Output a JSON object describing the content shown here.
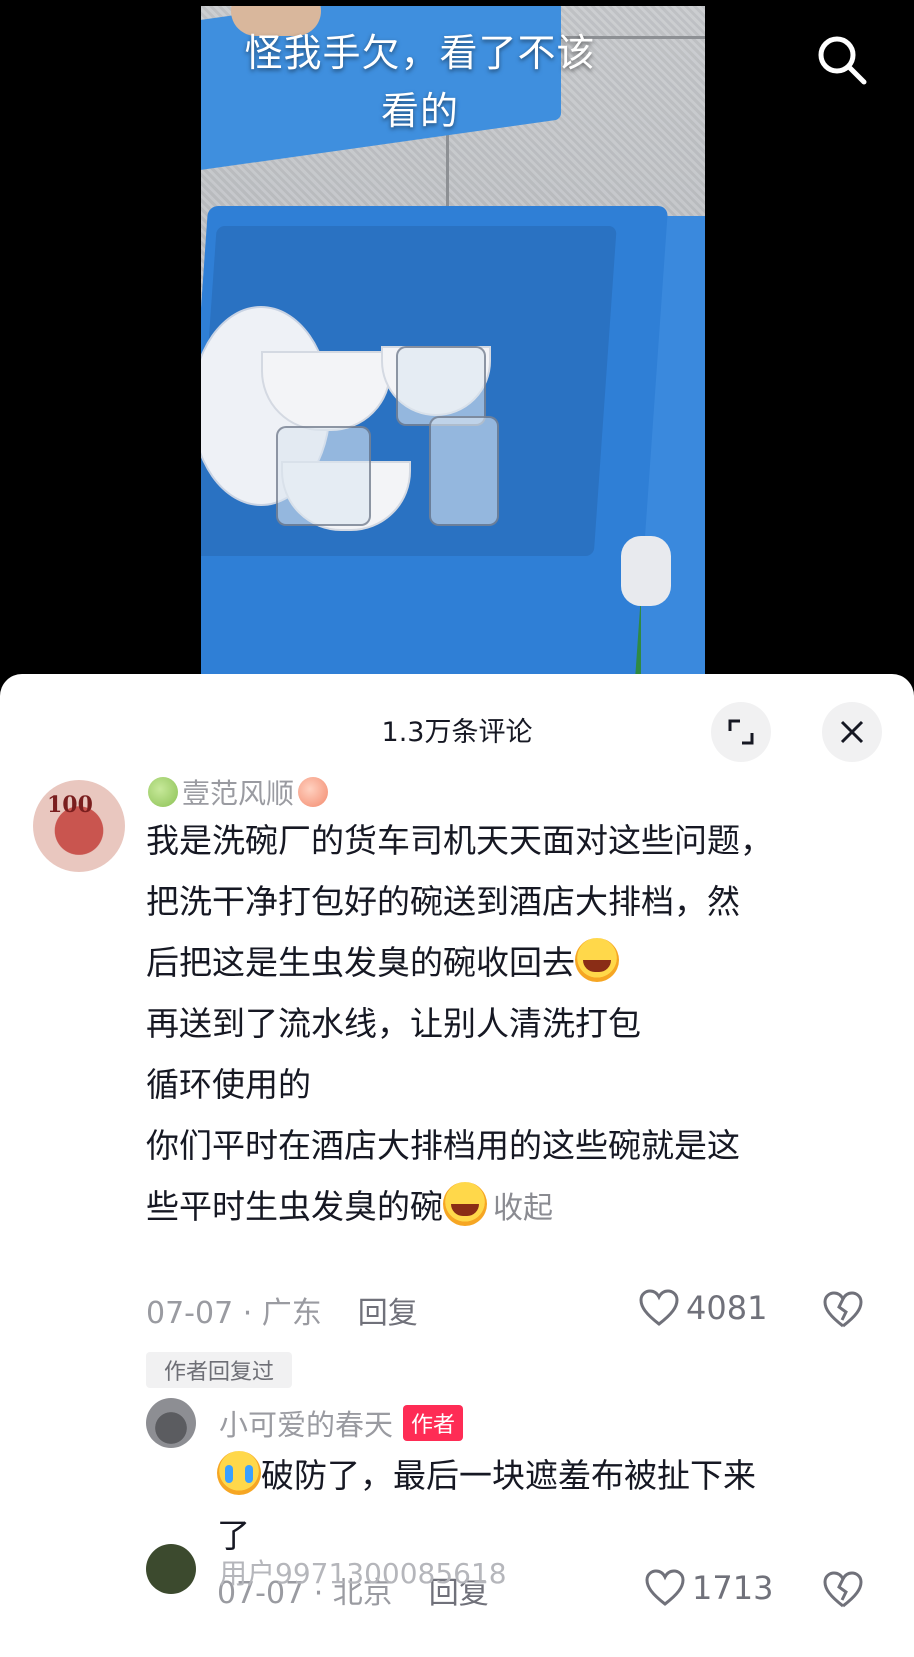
{
  "video": {
    "overlay_caption": "怪我手欠，看了不该看的"
  },
  "comments_panel": {
    "count_label": "1.3万条评论"
  },
  "comment": {
    "username": "壹范风顺",
    "avatar_text": "100",
    "text_lines": [
      "我是洗碗厂的货车司机天天面对这些问题，",
      "把洗干净打包好的碗送到酒店大排档，然",
      "后把这是生虫发臭的碗收回去",
      "再送到了流水线，让别人清洗打包",
      "循环使用的",
      "你们平时在酒店大排档用的这些碗就是这",
      "些平时生虫发臭的碗"
    ],
    "collapse_label": "收起",
    "date_location": "07-07 · 广东",
    "reply_label": "回复",
    "like_count": "4081",
    "author_replied_label": "作者回复过"
  },
  "reply": {
    "username": "小可爱的春天",
    "author_badge": "作者",
    "text_line1": "破防了，最后一块遮羞布被扯下来",
    "text_line2": "了",
    "date_location": "07-07 · 北京",
    "reply_label": "回复",
    "like_count": "1713"
  },
  "next_comment": {
    "username_partial": "用户9971300085618"
  },
  "colors": {
    "accent": "#fe2c55",
    "text_primary": "#161823",
    "text_secondary": "#9a9ba1",
    "bin_blue": "#2f7fd6"
  },
  "icons": [
    "search-icon",
    "expand-icon",
    "close-icon",
    "heart-icon",
    "broken-heart-icon"
  ]
}
